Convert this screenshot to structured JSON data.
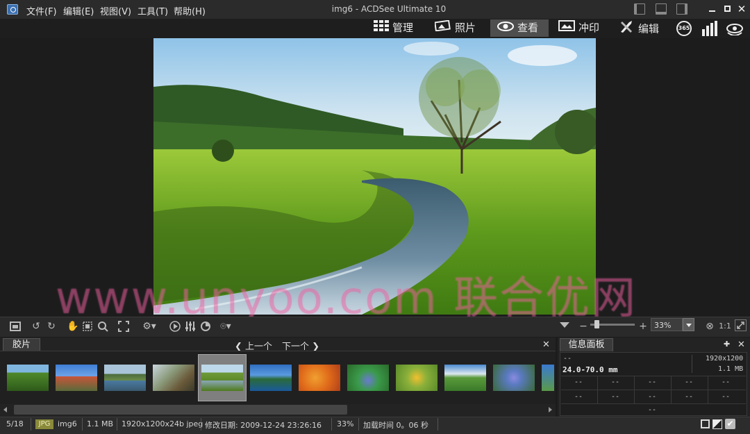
{
  "window": {
    "title": "img6 - ACDSee Ultimate 10"
  },
  "menu": {
    "items": [
      "文件(F)",
      "编辑(E)",
      "视图(V)",
      "工具(T)",
      "帮助(H)"
    ]
  },
  "modes": {
    "manage": "管理",
    "photos": "照片",
    "view": "查看",
    "print": "冲印",
    "edit": "编辑",
    "days365": "365"
  },
  "toolbar": {
    "zoom_value": "33%",
    "ratio": "1:1"
  },
  "filmstrip": {
    "tab": "胶片",
    "prev": "上一个",
    "next": "下一个"
  },
  "info_panel": {
    "tab": "信息面板",
    "resolution": "1920x1200",
    "top_left": "--",
    "lens": "24.0-70.0 mm",
    "size": "1.1 MB",
    "grid": [
      "--",
      "--",
      "--",
      "--",
      "--",
      "--",
      "--",
      "--",
      "--",
      "--"
    ],
    "footer": "--"
  },
  "status": {
    "position": "5/18",
    "format": "JPG",
    "filename": "img6",
    "filesize": "1.1 MB",
    "dimensions": "1920x1200x24b jpeg",
    "modified": "修改日期: 2009-12-24 23:26:16",
    "zoom": "33%",
    "load_time": "加载时间 0。06 秒"
  },
  "watermark": "www.unyoo.com 联合优网",
  "colors": {
    "accent": "#4e4e4e",
    "background": "#1c1c1c",
    "badge": "#8a8a3a"
  }
}
